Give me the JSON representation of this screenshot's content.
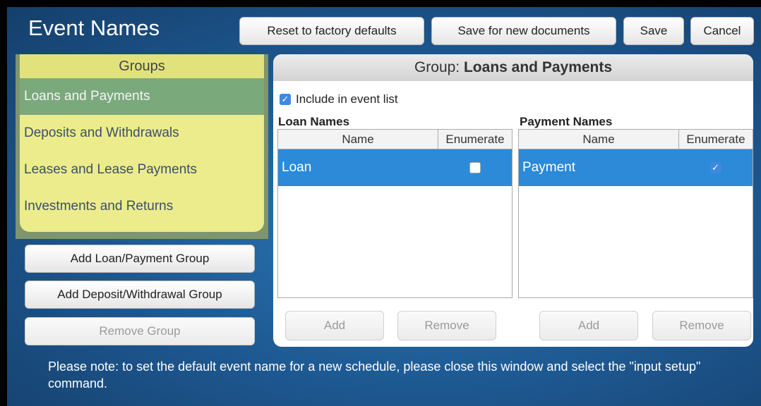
{
  "window": {
    "title": "Event Names"
  },
  "toolbar": {
    "reset_label": "Reset to factory defaults",
    "save_new_label": "Save for new documents",
    "save_label": "Save",
    "cancel_label": "Cancel"
  },
  "groups": {
    "header": "Groups",
    "items": [
      {
        "label": "Loans and Payments",
        "selected": true
      },
      {
        "label": "Deposits and Withdrawals"
      },
      {
        "label": "Leases and Lease Payments"
      },
      {
        "label": "Investments and Returns"
      }
    ],
    "add_loan_label": "Add Loan/Payment Group",
    "add_deposit_label": "Add Deposit/Withdrawal Group",
    "remove_label": "Remove Group"
  },
  "panel": {
    "header_prefix": "Group: ",
    "header_name": "Loans and Payments",
    "include_label": "Include in event list",
    "include_checked": true,
    "loan": {
      "title": "Loan Names",
      "col_name": "Name",
      "col_enumerate": "Enumerate",
      "rows": [
        {
          "name": "Loan",
          "enumerate": false
        }
      ],
      "add_label": "Add",
      "remove_label": "Remove"
    },
    "payment": {
      "title": "Payment Names",
      "col_name": "Name",
      "col_enumerate": "Enumerate",
      "rows": [
        {
          "name": "Payment",
          "enumerate": true
        }
      ],
      "add_label": "Add",
      "remove_label": "Remove"
    }
  },
  "note": "Please note: to set the default event name for a new schedule, please close this window and select the \"input setup\" command.",
  "colors": {
    "accent": "#2c8ad8",
    "groups_bg": "#ecec8d",
    "group_selected": "#7aa97b",
    "window_bg": "#1f5c96"
  },
  "icons": {
    "checkbox_checked": "checkbox-checked-icon",
    "checkbox_unchecked": "checkbox-unchecked-icon"
  }
}
